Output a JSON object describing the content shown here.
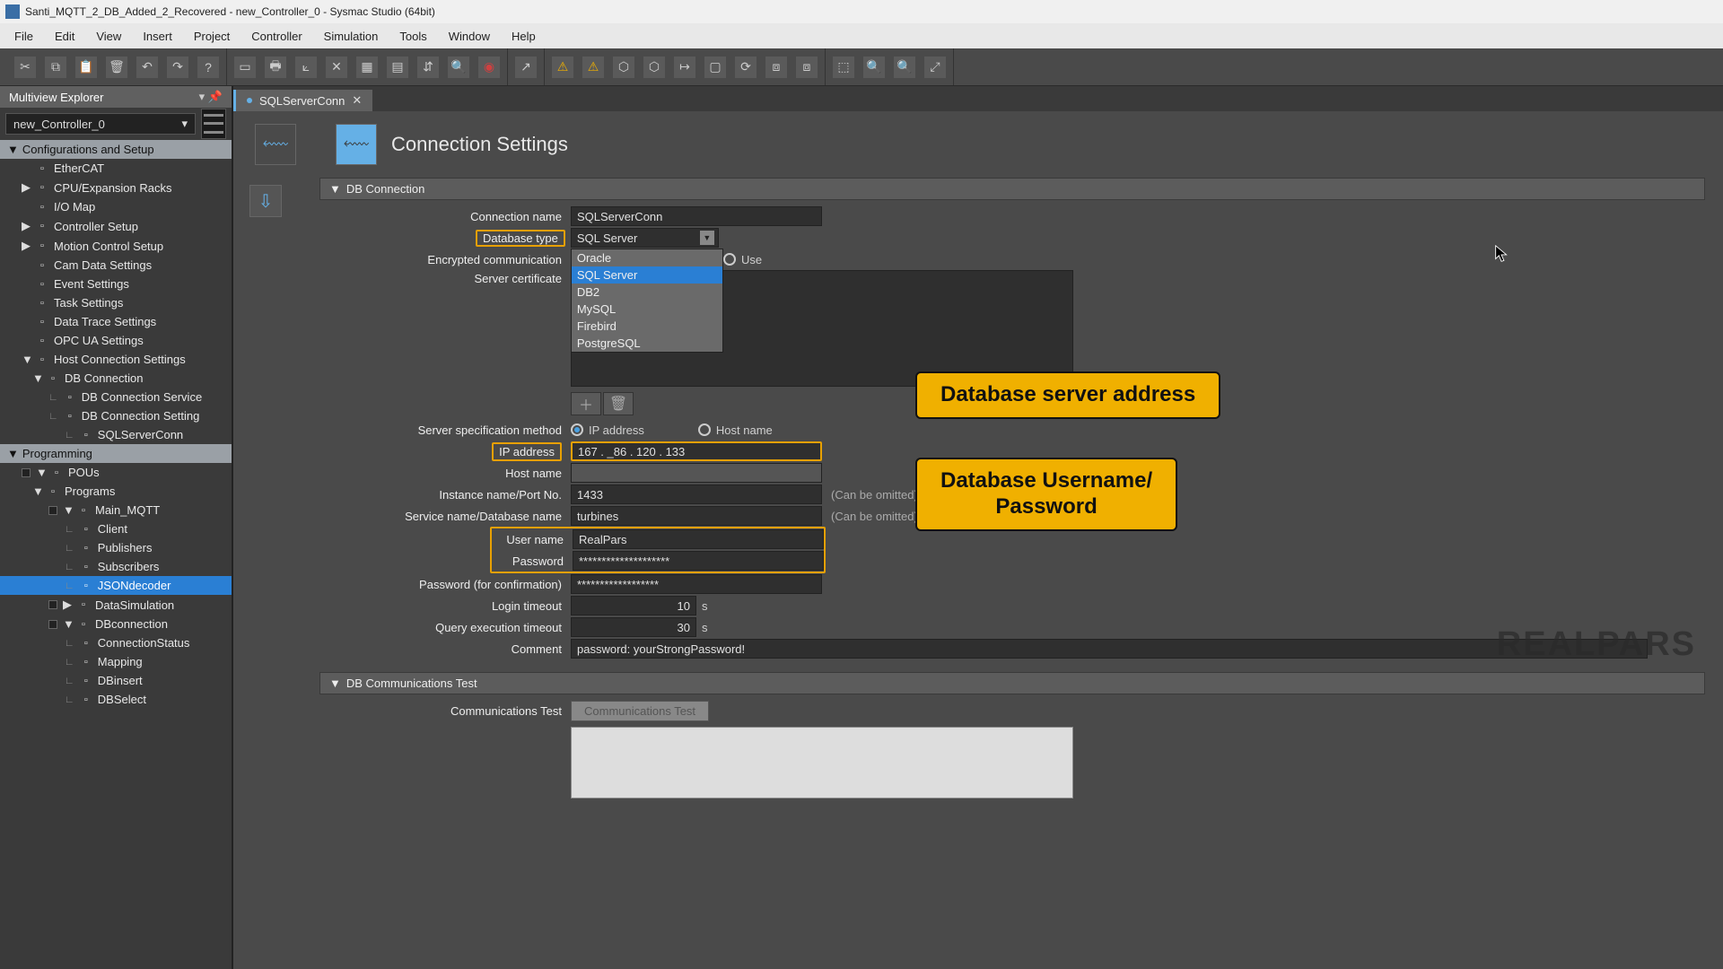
{
  "window": {
    "title": "Santi_MQTT_2_DB_Added_2_Recovered - new_Controller_0 - Sysmac Studio (64bit)"
  },
  "menu": {
    "items": [
      "File",
      "Edit",
      "View",
      "Insert",
      "Project",
      "Controller",
      "Simulation",
      "Tools",
      "Window",
      "Help"
    ]
  },
  "sidebar": {
    "title": "Multiview Explorer",
    "controller": "new_Controller_0",
    "sections": {
      "config": "Configurations and Setup",
      "programming": "Programming"
    },
    "config_items": [
      {
        "label": "EtherCAT",
        "lvl": 0
      },
      {
        "label": "CPU/Expansion Racks",
        "lvl": 0,
        "arrow": true
      },
      {
        "label": "I/O Map",
        "lvl": 0
      },
      {
        "label": "Controller Setup",
        "lvl": 0,
        "arrow": true
      },
      {
        "label": "Motion Control Setup",
        "lvl": 0,
        "arrow": true
      },
      {
        "label": "Cam Data Settings",
        "lvl": 0
      },
      {
        "label": "Event Settings",
        "lvl": 0
      },
      {
        "label": "Task Settings",
        "lvl": 0
      },
      {
        "label": "Data Trace Settings",
        "lvl": 0
      },
      {
        "label": "OPC UA Settings",
        "lvl": 0
      },
      {
        "label": "Host Connection Settings",
        "lvl": 0,
        "arrow": true,
        "open": true
      },
      {
        "label": "DB Connection",
        "lvl": 1,
        "arrow": true,
        "open": true
      },
      {
        "label": "DB Connection Service",
        "lvl": 2,
        "elbow": true
      },
      {
        "label": "DB Connection Setting",
        "lvl": 2,
        "elbow": true,
        "open": true
      },
      {
        "label": "SQLServerConn",
        "lvl": 3,
        "elbow": true
      }
    ],
    "prog_items": [
      {
        "label": "POUs",
        "lvl": 0,
        "arrow": true,
        "open": true,
        "stop": true
      },
      {
        "label": "Programs",
        "lvl": 1,
        "arrow": true,
        "open": true
      },
      {
        "label": "Main_MQTT",
        "lvl": 2,
        "arrow": true,
        "open": true,
        "stop": true
      },
      {
        "label": "Client",
        "lvl": 3,
        "elbow": true
      },
      {
        "label": "Publishers",
        "lvl": 3,
        "elbow": true
      },
      {
        "label": "Subscribers",
        "lvl": 3,
        "elbow": true
      },
      {
        "label": "JSONdecoder",
        "lvl": 3,
        "elbow": true,
        "sel": true
      },
      {
        "label": "DataSimulation",
        "lvl": 2,
        "arrow": true,
        "stop": true
      },
      {
        "label": "DBconnection",
        "lvl": 2,
        "arrow": true,
        "open": true,
        "stop": true
      },
      {
        "label": "ConnectionStatus",
        "lvl": 3,
        "elbow": true
      },
      {
        "label": "Mapping",
        "lvl": 3,
        "elbow": true
      },
      {
        "label": "DBinsert",
        "lvl": 3,
        "elbow": true
      },
      {
        "label": "DBSelect",
        "lvl": 3,
        "elbow": true
      }
    ]
  },
  "tab": {
    "label": "SQLServerConn"
  },
  "page": {
    "title": "Connection Settings"
  },
  "sections": {
    "db_conn": "DB Connection",
    "db_test": "DB Communications Test"
  },
  "form": {
    "connection_name": {
      "label": "Connection name",
      "value": "SQLServerConn"
    },
    "database_type": {
      "label": "Database type",
      "value": "SQL Server",
      "options": [
        "Oracle",
        "SQL Server",
        "DB2",
        "MySQL",
        "Firebird",
        "PostgreSQL"
      ],
      "selected_index": 1
    },
    "encrypted": {
      "label": "Encrypted communication",
      "use": "Use"
    },
    "server_cert": {
      "label": "Server certificate"
    },
    "spec_method": {
      "label": "Server specification method",
      "opt_ip": "IP address",
      "opt_host": "Host name"
    },
    "ip_address": {
      "label": "IP address",
      "value": "167 . _86 . 120 . 133"
    },
    "host_name": {
      "label": "Host name",
      "value": ""
    },
    "instance": {
      "label": "Instance name/Port No.",
      "value": "1433",
      "hint": "(Can be omitted)"
    },
    "service_db": {
      "label": "Service name/Database name",
      "value": "turbines",
      "hint": "(Can be omitted)"
    },
    "user_name": {
      "label": "User name",
      "value": "RealPars"
    },
    "password": {
      "label": "Password",
      "value": "********************"
    },
    "password_conf": {
      "label": "Password (for confirmation)",
      "value": "******************"
    },
    "login_timeout": {
      "label": "Login timeout",
      "value": "10",
      "unit": "s"
    },
    "query_timeout": {
      "label": "Query execution timeout",
      "value": "30",
      "unit": "s"
    },
    "comment": {
      "label": "Comment",
      "value": "password: yourStrongPassword!"
    },
    "comms_test": {
      "label": "Communications Test",
      "button": "Communications Test"
    }
  },
  "callouts": {
    "addr": "Database server address",
    "userpass": "Database Username/\nPassword"
  },
  "watermark": "REALPARS"
}
